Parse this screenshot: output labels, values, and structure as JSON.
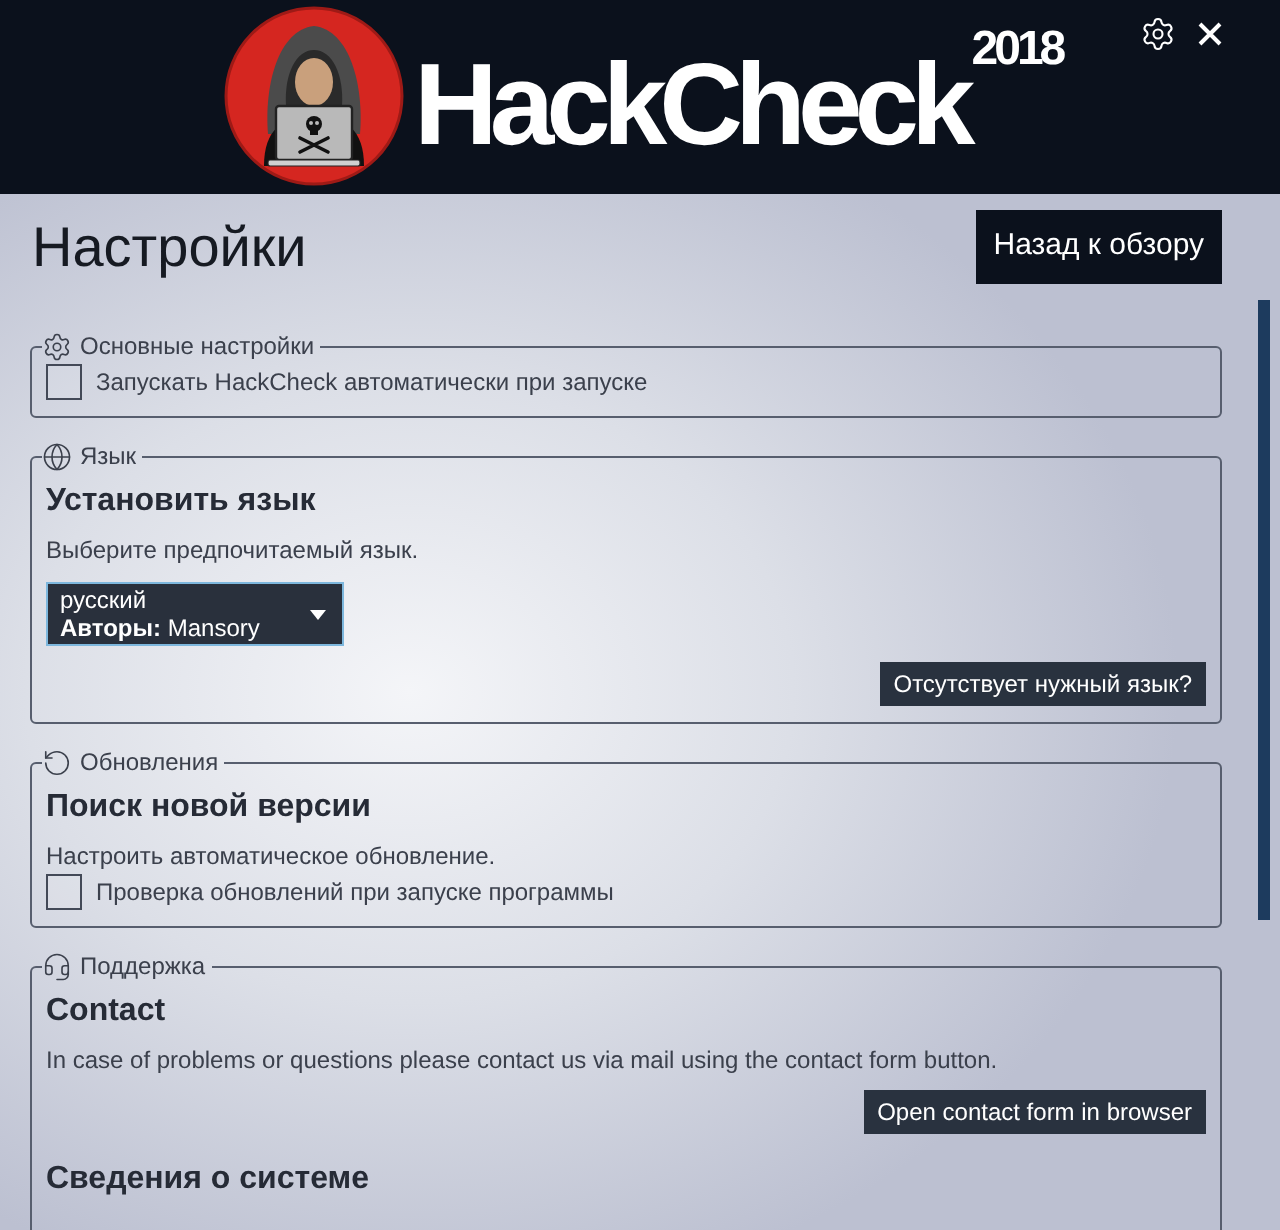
{
  "header": {
    "logo_text": "HackCheck",
    "logo_year": "2018"
  },
  "page": {
    "title": "Настройки",
    "back_button": "Назад к обзору"
  },
  "groups": [
    {
      "legend": "Основные настройки",
      "items": [
        {
          "kind": "checkbox",
          "label": "Запускать HackCheck автоматически при запуске",
          "checked": false
        }
      ]
    },
    {
      "legend": "Язык",
      "items": [
        {
          "kind": "heading",
          "text": "Установить язык"
        },
        {
          "kind": "text",
          "text": "Выберите предпочитаемый язык."
        },
        {
          "kind": "dropdown",
          "value": "русский",
          "detail": "**Авторы:** Mansory"
        },
        {
          "kind": "button",
          "label": "Отсутствует нужный язык?"
        }
      ]
    },
    {
      "legend": "Обновления",
      "items": [
        {
          "kind": "heading",
          "text": "Поиск новой версии"
        },
        {
          "kind": "text",
          "text": "Настроить автоматическое обновление."
        },
        {
          "kind": "checkbox",
          "label": "Проверка обновлений при запуске программы",
          "checked": false
        }
      ]
    },
    {
      "legend": "Поддержка",
      "items": [
        {
          "kind": "heading",
          "text": "Contact"
        },
        {
          "kind": "text",
          "text": "In case of problems or questions please contact us via mail using the contact form button."
        },
        {
          "kind": "button",
          "label": "Open contact form in browser"
        },
        {
          "kind": "heading",
          "text": "Сведения о системе"
        }
      ]
    }
  ]
}
